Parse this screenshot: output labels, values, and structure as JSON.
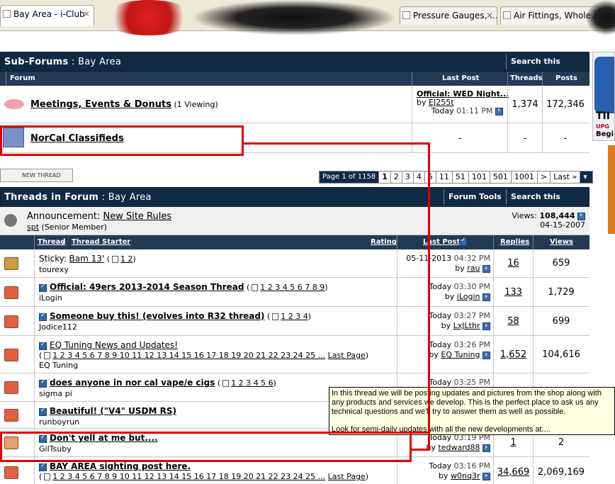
{
  "browser": {
    "tabs": [
      {
        "label": "Bay Area - i-Club",
        "active": true
      },
      {
        "label": "Pressure Gauges, ...",
        "active": false
      },
      {
        "label": "Air Fittings, Whole...",
        "active": false
      }
    ],
    "close_glyph": "✕"
  },
  "subforums": {
    "title": "Sub-Forums",
    "section": " : Bay Area",
    "search_label": "Search this Forum ▾",
    "headers": {
      "forum": "Forum",
      "last_post": "Last Post",
      "threads": "Threads",
      "posts": "Posts"
    },
    "items": [
      {
        "name": "Meetings, Events & Donuts",
        "viewing": "(1 Viewing)",
        "last_title": "Official: WED Night...",
        "by": "by",
        "last_user": "EJ255t",
        "last_date": "Today",
        "last_time": "01:11 PM",
        "threads": "1,374",
        "posts": "172,346"
      },
      {
        "name": "NorCal Classifieds",
        "viewing": "",
        "last_title": "-",
        "threads": "-",
        "posts": "-"
      }
    ]
  },
  "toolbar": {
    "new_thread_label": "NEW THREAD",
    "pager": {
      "label": "Page 1 of 1158",
      "pages": [
        "1",
        "2",
        "3",
        "4",
        "5",
        "11",
        "51",
        "101",
        "501",
        "1001",
        ">",
        "Last »"
      ],
      "current": "1",
      "menu_arrow": "▾"
    }
  },
  "threads": {
    "title": "Threads in Forum",
    "section": " : Bay Area",
    "tools_label": "Forum Tools ▾",
    "search_label": "Search this Forum ▾",
    "announcement": {
      "prefix": "Announcement:",
      "title": "New Site Rules",
      "user": "spt",
      "role": "(Senior Member)",
      "views_label": "Views:",
      "views": "108,444",
      "date": "04-15-2007"
    },
    "headers": {
      "thread": "Thread",
      "slash": " / ",
      "starter": "Thread Starter",
      "rating": "Rating",
      "last_post": "Last Post",
      "replies": "Replies",
      "views": "Views"
    },
    "rows": [
      {
        "prefix": "Sticky:",
        "title": "Bam 13'",
        "pages": "1 2",
        "starter": "tourexy",
        "date": "05-11-2013",
        "time": "04:32 PM",
        "by": "by",
        "user": "rau",
        "replies": "16",
        "views": "659"
      },
      {
        "prefix": "",
        "title": "Official: 49ers 2013-2014 Season Thread",
        "pages": "1 2 3 4 5 6 7 8 9",
        "starter": "iLogin",
        "date": "Today",
        "time": "03:30 PM",
        "by": "by",
        "user": "iLogin",
        "replies": "133",
        "views": "1,729"
      },
      {
        "prefix": "",
        "title": "Someone buy this! (evolves into R32 thread)",
        "pages": "1 2 3 4",
        "starter": "Jodice112",
        "date": "Today",
        "time": "03:27 PM",
        "by": "by",
        "user": "LxJLthr",
        "replies": "58",
        "views": "699"
      },
      {
        "prefix": "",
        "title": "EQ Tuning News and Updates!",
        "pages": "1 2 3 4 5 6 7 8 9 10 11 12 13 14 15 16 17 18 19 20 21 22 23 24 25 ...",
        "last_page": "Last Page",
        "starter": "EQ Tuning",
        "date": "Today",
        "time": "03:26 PM",
        "by": "by",
        "user": "EQ Tuning",
        "replies": "1,652",
        "views": "104,616"
      },
      {
        "prefix": "",
        "title": "does anyone in nor cal vape/e cigs",
        "pages": "1 2 3 4 5 6",
        "starter": "sigma pi",
        "date": "Today",
        "time": "03:25 PM",
        "by": "",
        "user": "",
        "replies": "",
        "views": ""
      },
      {
        "prefix": "",
        "title": "Beautiful! (\"V4\" USDM RS)",
        "pages": "",
        "starter": "runboyrun",
        "date": "",
        "time": "",
        "by": "",
        "user": "",
        "replies": "",
        "views": ""
      },
      {
        "prefix": "",
        "title": "Don't yell at me but....",
        "pages": "",
        "starter": "GilTsuby",
        "date": "Today",
        "time": "03:19 PM",
        "by": "by",
        "user": "tedward88",
        "replies": "1",
        "views": "2"
      },
      {
        "prefix": "",
        "title": "BAY AREA sighting post here.",
        "pages": "1 2 3 4 5 6 7 8 9 10 11 12 13 14 15 16 17 18 19 20 21 22 23 24 25 ...",
        "last_page": "Last Page",
        "starter": "",
        "date": "Today",
        "time": "03:16 PM",
        "by": "by",
        "user": "w0nq3r",
        "replies": "34,669",
        "views": "2,069,169"
      }
    ]
  },
  "tooltip": {
    "text": "In this thread we will be posting updates and pictures from the shop along with any products and services we develop. This is the perfect place to ask us any technical questions and we'll try to answer them as well as possible.",
    "text2": "Look for semi-daily updates with all the new developments at...."
  },
  "ad": {
    "text": "TII",
    "sub": "UPG",
    "begin": "Begi"
  },
  "colors": {
    "header": "#0f2a44",
    "annotation": "#e00000",
    "tooltip_bg": "#ffffe1"
  }
}
